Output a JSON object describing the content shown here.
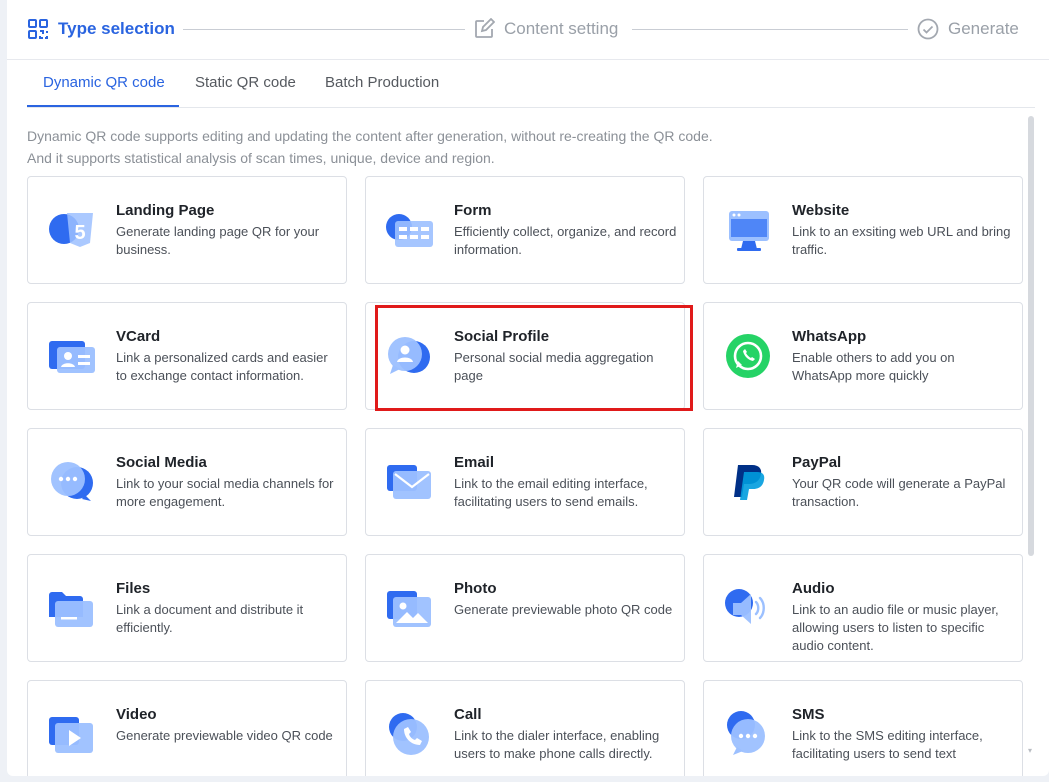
{
  "stepper": {
    "steps": [
      {
        "label": "Type selection",
        "icon": "qr-scan-icon"
      },
      {
        "label": "Content setting",
        "icon": "edit-icon"
      },
      {
        "label": "Generate",
        "icon": "check-circle-icon"
      }
    ]
  },
  "tabs": [
    "Dynamic QR code",
    "Static QR code",
    "Batch Production"
  ],
  "description": {
    "line1": "Dynamic QR code supports editing and updating the content after generation, without re-creating the QR code.",
    "line2": "And it supports statistical analysis of scan times, unique, device and region."
  },
  "cards": [
    {
      "title": "Landing Page",
      "text": "Generate landing page QR for your business.",
      "icon": "html5-icon"
    },
    {
      "title": "Form",
      "text": "Efficiently collect, organize, and record information.",
      "icon": "form-icon"
    },
    {
      "title": "Website",
      "text": "Link to an exsiting web URL and bring traffic.",
      "icon": "monitor-icon"
    },
    {
      "title": "VCard",
      "text": "Link a personalized cards and easier to exchange contact information.",
      "icon": "id-card-icon"
    },
    {
      "title": "Social Profile",
      "text": "Personal social media aggregation page",
      "icon": "profile-chat-icon"
    },
    {
      "title": "WhatsApp",
      "text": "Enable others to add you on WhatsApp more quickly",
      "icon": "whatsapp-icon"
    },
    {
      "title": "Social Media",
      "text": "Link to your social media channels for more engagement.",
      "icon": "chat-bubbles-icon"
    },
    {
      "title": "Email",
      "text": "Link to the email editing interface, facilitating users to send emails.",
      "icon": "envelope-icon"
    },
    {
      "title": "PayPal",
      "text": "Your QR code will generate a PayPal transaction.",
      "icon": "paypal-icon"
    },
    {
      "title": "Files",
      "text": "Link a document and distribute it efficiently.",
      "icon": "folder-icon"
    },
    {
      "title": "Photo",
      "text": "Generate previewable photo QR code",
      "icon": "photo-icon"
    },
    {
      "title": "Audio",
      "text": "Link to an audio file or music player, allowing users to listen to specific audio content.",
      "icon": "speaker-icon"
    },
    {
      "title": "Video",
      "text": "Generate previewable video QR code",
      "icon": "video-play-icon"
    },
    {
      "title": "Call",
      "text": "Link to the dialer interface, enabling users to make phone calls directly.",
      "icon": "phone-icon"
    },
    {
      "title": "SMS",
      "text": "Link to the SMS editing interface, facilitating users to send text",
      "icon": "sms-bubble-icon"
    }
  ],
  "colors": {
    "accent": "#2a64e0",
    "highlight": "#e01a1a",
    "whatsapp": "#25d366",
    "paypal_dark": "#003087",
    "paypal_light": "#009cde"
  }
}
